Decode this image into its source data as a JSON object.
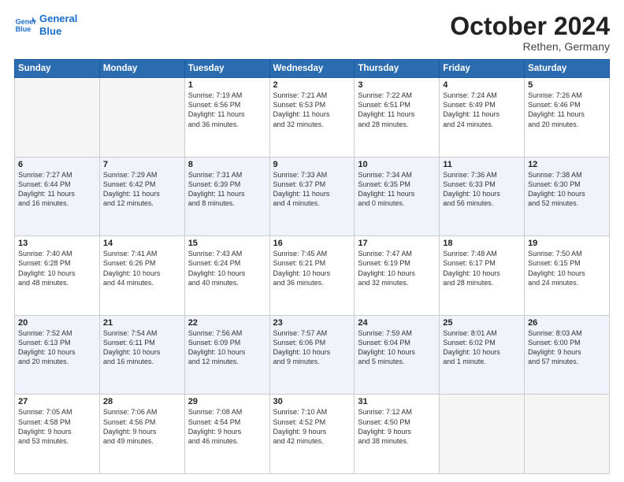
{
  "header": {
    "logo_line1": "General",
    "logo_line2": "Blue",
    "month_title": "October 2024",
    "location": "Rethen, Germany"
  },
  "days_of_week": [
    "Sunday",
    "Monday",
    "Tuesday",
    "Wednesday",
    "Thursday",
    "Friday",
    "Saturday"
  ],
  "weeks": [
    [
      {
        "day": "",
        "info": ""
      },
      {
        "day": "",
        "info": ""
      },
      {
        "day": "1",
        "info": "Sunrise: 7:19 AM\nSunset: 6:56 PM\nDaylight: 11 hours\nand 36 minutes."
      },
      {
        "day": "2",
        "info": "Sunrise: 7:21 AM\nSunset: 6:53 PM\nDaylight: 11 hours\nand 32 minutes."
      },
      {
        "day": "3",
        "info": "Sunrise: 7:22 AM\nSunset: 6:51 PM\nDaylight: 11 hours\nand 28 minutes."
      },
      {
        "day": "4",
        "info": "Sunrise: 7:24 AM\nSunset: 6:49 PM\nDaylight: 11 hours\nand 24 minutes."
      },
      {
        "day": "5",
        "info": "Sunrise: 7:26 AM\nSunset: 6:46 PM\nDaylight: 11 hours\nand 20 minutes."
      }
    ],
    [
      {
        "day": "6",
        "info": "Sunrise: 7:27 AM\nSunset: 6:44 PM\nDaylight: 11 hours\nand 16 minutes."
      },
      {
        "day": "7",
        "info": "Sunrise: 7:29 AM\nSunset: 6:42 PM\nDaylight: 11 hours\nand 12 minutes."
      },
      {
        "day": "8",
        "info": "Sunrise: 7:31 AM\nSunset: 6:39 PM\nDaylight: 11 hours\nand 8 minutes."
      },
      {
        "day": "9",
        "info": "Sunrise: 7:33 AM\nSunset: 6:37 PM\nDaylight: 11 hours\nand 4 minutes."
      },
      {
        "day": "10",
        "info": "Sunrise: 7:34 AM\nSunset: 6:35 PM\nDaylight: 11 hours\nand 0 minutes."
      },
      {
        "day": "11",
        "info": "Sunrise: 7:36 AM\nSunset: 6:33 PM\nDaylight: 10 hours\nand 56 minutes."
      },
      {
        "day": "12",
        "info": "Sunrise: 7:38 AM\nSunset: 6:30 PM\nDaylight: 10 hours\nand 52 minutes."
      }
    ],
    [
      {
        "day": "13",
        "info": "Sunrise: 7:40 AM\nSunset: 6:28 PM\nDaylight: 10 hours\nand 48 minutes."
      },
      {
        "day": "14",
        "info": "Sunrise: 7:41 AM\nSunset: 6:26 PM\nDaylight: 10 hours\nand 44 minutes."
      },
      {
        "day": "15",
        "info": "Sunrise: 7:43 AM\nSunset: 6:24 PM\nDaylight: 10 hours\nand 40 minutes."
      },
      {
        "day": "16",
        "info": "Sunrise: 7:45 AM\nSunset: 6:21 PM\nDaylight: 10 hours\nand 36 minutes."
      },
      {
        "day": "17",
        "info": "Sunrise: 7:47 AM\nSunset: 6:19 PM\nDaylight: 10 hours\nand 32 minutes."
      },
      {
        "day": "18",
        "info": "Sunrise: 7:48 AM\nSunset: 6:17 PM\nDaylight: 10 hours\nand 28 minutes."
      },
      {
        "day": "19",
        "info": "Sunrise: 7:50 AM\nSunset: 6:15 PM\nDaylight: 10 hours\nand 24 minutes."
      }
    ],
    [
      {
        "day": "20",
        "info": "Sunrise: 7:52 AM\nSunset: 6:13 PM\nDaylight: 10 hours\nand 20 minutes."
      },
      {
        "day": "21",
        "info": "Sunrise: 7:54 AM\nSunset: 6:11 PM\nDaylight: 10 hours\nand 16 minutes."
      },
      {
        "day": "22",
        "info": "Sunrise: 7:56 AM\nSunset: 6:09 PM\nDaylight: 10 hours\nand 12 minutes."
      },
      {
        "day": "23",
        "info": "Sunrise: 7:57 AM\nSunset: 6:06 PM\nDaylight: 10 hours\nand 9 minutes."
      },
      {
        "day": "24",
        "info": "Sunrise: 7:59 AM\nSunset: 6:04 PM\nDaylight: 10 hours\nand 5 minutes."
      },
      {
        "day": "25",
        "info": "Sunrise: 8:01 AM\nSunset: 6:02 PM\nDaylight: 10 hours\nand 1 minute."
      },
      {
        "day": "26",
        "info": "Sunrise: 8:03 AM\nSunset: 6:00 PM\nDaylight: 9 hours\nand 57 minutes."
      }
    ],
    [
      {
        "day": "27",
        "info": "Sunrise: 7:05 AM\nSunset: 4:58 PM\nDaylight: 9 hours\nand 53 minutes."
      },
      {
        "day": "28",
        "info": "Sunrise: 7:06 AM\nSunset: 4:56 PM\nDaylight: 9 hours\nand 49 minutes."
      },
      {
        "day": "29",
        "info": "Sunrise: 7:08 AM\nSunset: 4:54 PM\nDaylight: 9 hours\nand 46 minutes."
      },
      {
        "day": "30",
        "info": "Sunrise: 7:10 AM\nSunset: 4:52 PM\nDaylight: 9 hours\nand 42 minutes."
      },
      {
        "day": "31",
        "info": "Sunrise: 7:12 AM\nSunset: 4:50 PM\nDaylight: 9 hours\nand 38 minutes."
      },
      {
        "day": "",
        "info": ""
      },
      {
        "day": "",
        "info": ""
      }
    ]
  ]
}
